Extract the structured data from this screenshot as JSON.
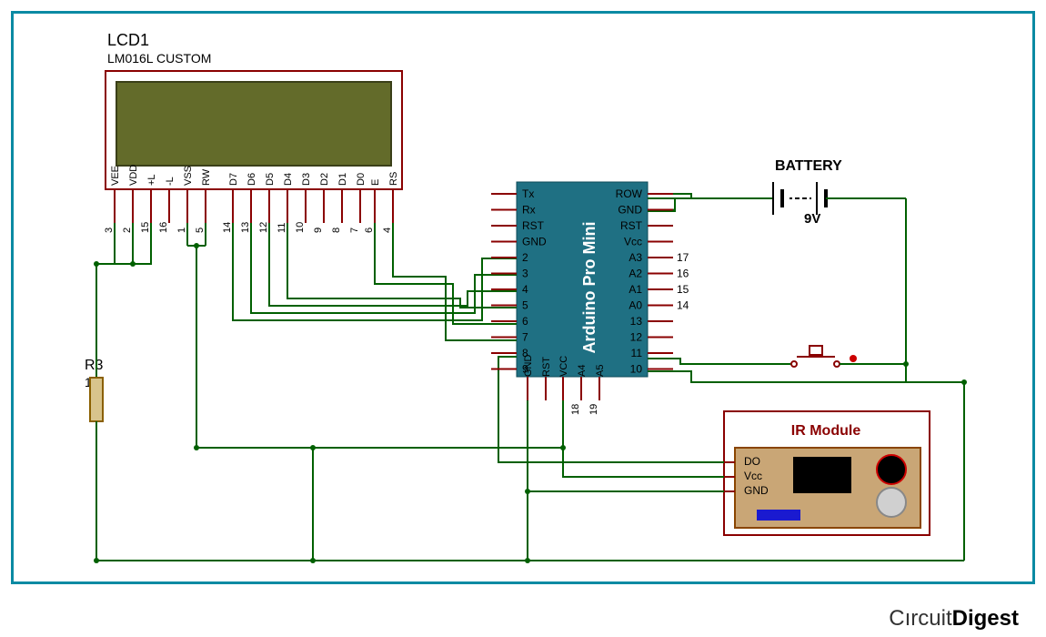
{
  "labels": {
    "lcd_name": "LCD1",
    "lcd_part": "LM016L CUSTOM",
    "battery": "BATTERY",
    "battery_volt": "9V",
    "resistor_name": "R3",
    "resistor_value": "1k",
    "ir_title": "IR Module",
    "mcu_title": "Arduino Pro Mini",
    "logo_a": "Cırcuit",
    "logo_b": "Digest"
  },
  "lcd_pins": [
    "VEE",
    "VDD",
    "+L",
    "-L",
    "VSS",
    "RW",
    "D7",
    "D6",
    "D5",
    "D4",
    "D3",
    "D2",
    "D1",
    "D0",
    "E",
    "RS"
  ],
  "lcd_nums": [
    "3",
    "2",
    "15",
    "16",
    "1",
    "5",
    "14",
    "13",
    "12",
    "11",
    "10",
    "9",
    "8",
    "7",
    "6",
    "4"
  ],
  "mcu_left": [
    "Tx",
    "Rx",
    "RST",
    "GND",
    "2",
    "3",
    "4",
    "5",
    "6",
    "7",
    "8",
    "9"
  ],
  "mcu_right": [
    "ROW",
    "GND",
    "RST",
    "Vcc",
    "A3",
    "A2",
    "A1",
    "A0",
    "13",
    "12",
    "11",
    "10"
  ],
  "mcu_right_nums": [
    "",
    "",
    "",
    "",
    "17",
    "16",
    "15",
    "14",
    "",
    "",
    "",
    ""
  ],
  "mcu_bottom": [
    "GND",
    "RST",
    "VCC",
    "A4",
    "A5"
  ],
  "mcu_bottom_nums": [
    "",
    "",
    "",
    "18",
    "19"
  ],
  "ir_pins": [
    "DO",
    "Vcc",
    "GND"
  ]
}
